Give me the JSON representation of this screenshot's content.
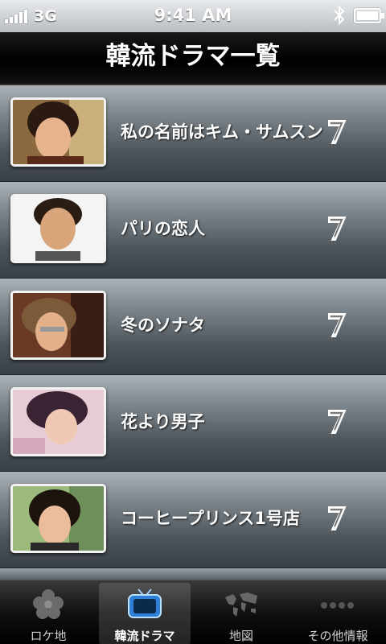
{
  "status_bar": {
    "network": "3G",
    "time": "9:41 AM",
    "icons": [
      "signal-icon",
      "bluetooth-icon",
      "battery-icon"
    ]
  },
  "header": {
    "title": "韓流ドラマ一覧"
  },
  "dramas": [
    {
      "title": "私の名前はキム・サムスン",
      "thumbnail": "portrait-1"
    },
    {
      "title": "パリの恋人",
      "thumbnail": "portrait-2"
    },
    {
      "title": "冬のソナタ",
      "thumbnail": "portrait-3"
    },
    {
      "title": "花より男子",
      "thumbnail": "portrait-4"
    },
    {
      "title": "コーヒープリンス1号店",
      "thumbnail": "portrait-5"
    }
  ],
  "tabs": [
    {
      "label": "ロケ地",
      "icon": "flower-icon",
      "active": false
    },
    {
      "label": "韓流ドラマ",
      "icon": "tv-icon",
      "active": true
    },
    {
      "label": "地図",
      "icon": "world-map-icon",
      "active": false
    },
    {
      "label": "その他情報",
      "icon": "more-icon",
      "active": false
    }
  ]
}
